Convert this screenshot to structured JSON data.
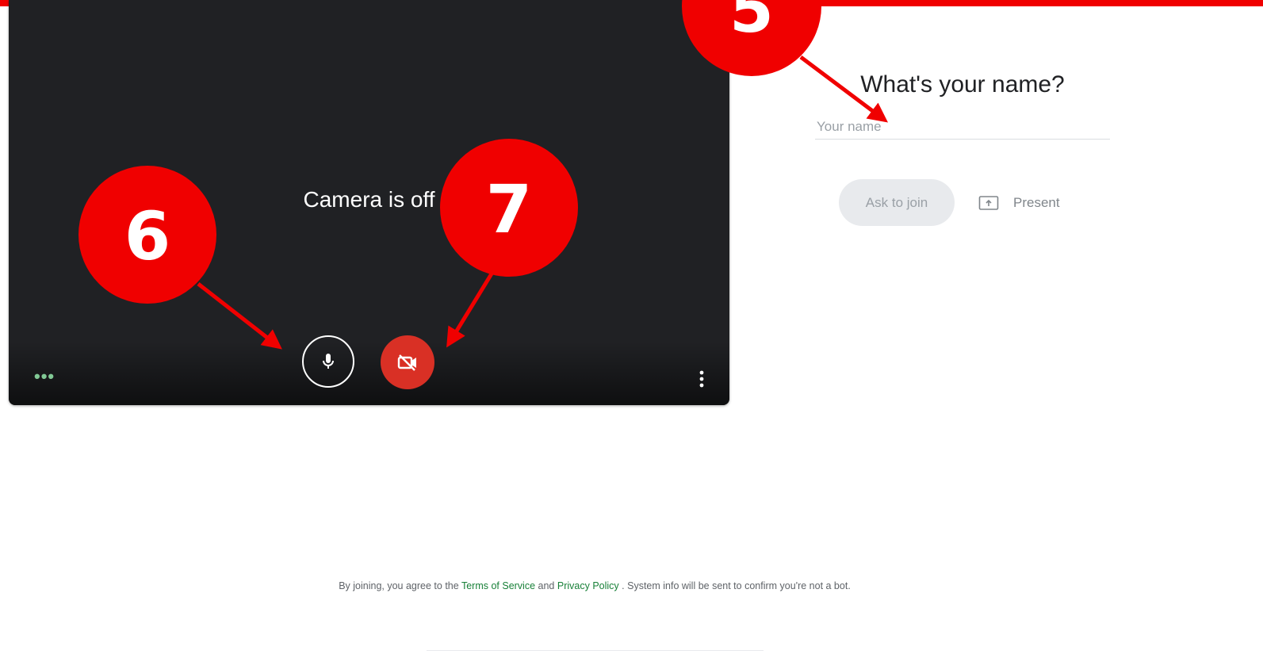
{
  "preview": {
    "camera_status": "Camera is off",
    "effects_label": "•••"
  },
  "join_panel": {
    "title": "What's your name?",
    "name_placeholder": "Your name",
    "ask_to_join_label": "Ask to join",
    "present_label": "Present"
  },
  "footer": {
    "prefix": "By joining, you agree to the",
    "terms_link": "Terms of Service",
    "and_text": "and",
    "privacy_link": "Privacy Policy",
    "suffix": ". System info will be sent to confirm you're not a bot."
  },
  "annotations": {
    "badge_5": "5",
    "badge_6": "6",
    "badge_7": "7"
  },
  "colors": {
    "annotation_red": "#f00000",
    "camera_off_red": "#d93025",
    "link_green": "#188038",
    "preview_bg": "#202124"
  },
  "icons": {
    "mic_button": "microphone-icon",
    "camera_button": "camera-off-icon",
    "more_options": "more-vert-icon",
    "present": "present-screen-icon"
  }
}
